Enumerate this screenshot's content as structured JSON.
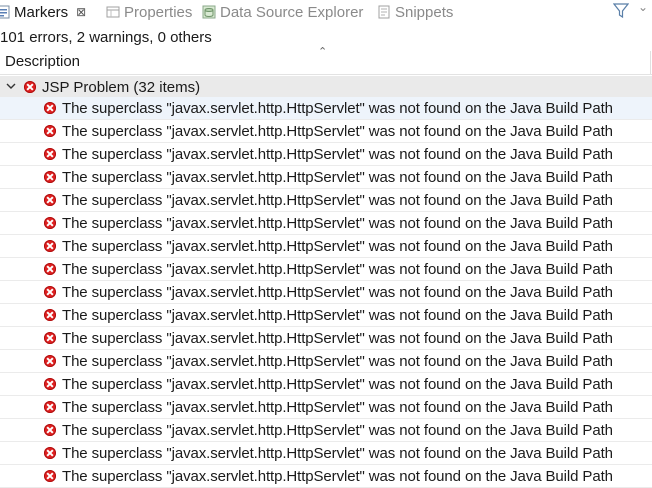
{
  "tabs": [
    {
      "label": "Markers",
      "active": true,
      "icon": "markers-icon",
      "close": "⊠"
    },
    {
      "label": "Properties",
      "active": false,
      "icon": "properties-icon"
    },
    {
      "label": "Data Source Explorer",
      "active": false,
      "icon": "data-source-explorer-icon"
    },
    {
      "label": "Snippets",
      "active": false,
      "icon": "snippets-icon"
    }
  ],
  "toolbar": {
    "filter_icon": "filter-icon",
    "menu_icon": "chevron-down-icon"
  },
  "summary": "101 errors, 2 warnings, 0 others",
  "columns": {
    "description": "Description"
  },
  "group": {
    "label": "JSP Problem (32 items)",
    "icon": "error-icon",
    "expanded": true
  },
  "rows": [
    "The superclass \"javax.servlet.http.HttpServlet\" was not found on the Java Build Path",
    "The superclass \"javax.servlet.http.HttpServlet\" was not found on the Java Build Path",
    "The superclass \"javax.servlet.http.HttpServlet\" was not found on the Java Build Path",
    "The superclass \"javax.servlet.http.HttpServlet\" was not found on the Java Build Path",
    "The superclass \"javax.servlet.http.HttpServlet\" was not found on the Java Build Path",
    "The superclass \"javax.servlet.http.HttpServlet\" was not found on the Java Build Path",
    "The superclass \"javax.servlet.http.HttpServlet\" was not found on the Java Build Path",
    "The superclass \"javax.servlet.http.HttpServlet\" was not found on the Java Build Path",
    "The superclass \"javax.servlet.http.HttpServlet\" was not found on the Java Build Path",
    "The superclass \"javax.servlet.http.HttpServlet\" was not found on the Java Build Path",
    "The superclass \"javax.servlet.http.HttpServlet\" was not found on the Java Build Path",
    "The superclass \"javax.servlet.http.HttpServlet\" was not found on the Java Build Path",
    "The superclass \"javax.servlet.http.HttpServlet\" was not found on the Java Build Path",
    "The superclass \"javax.servlet.http.HttpServlet\" was not found on the Java Build Path",
    "The superclass \"javax.servlet.http.HttpServlet\" was not found on the Java Build Path",
    "The superclass \"javax.servlet.http.HttpServlet\" was not found on the Java Build Path",
    "The superclass \"javax.servlet.http.HttpServlet\" was not found on the Java Build Path"
  ]
}
